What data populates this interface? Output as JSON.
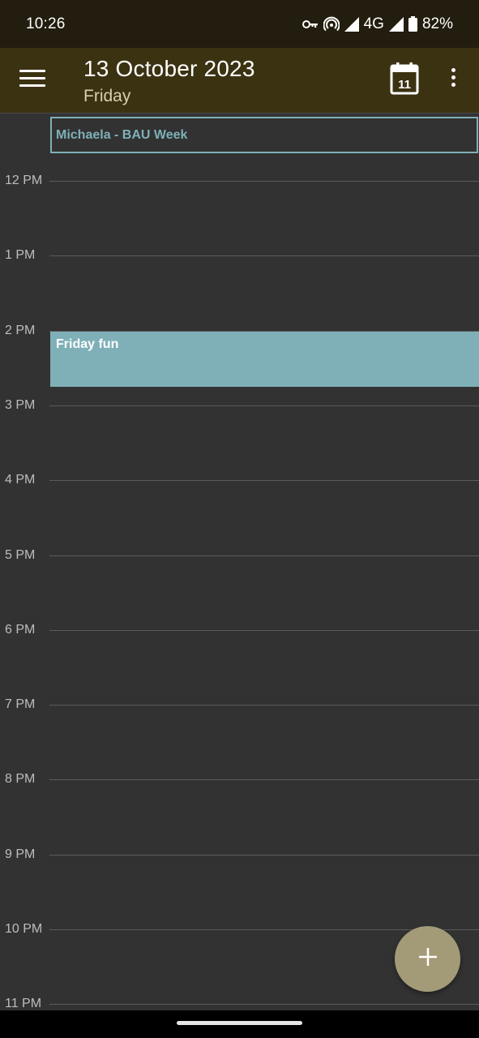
{
  "status_bar": {
    "time": "10:26",
    "network": "4G",
    "battery": "82%",
    "icons": [
      "vpn-key-icon",
      "hotspot-icon",
      "signal-icon",
      "signal-icon",
      "battery-icon"
    ]
  },
  "app_bar": {
    "title": "13 October 2023",
    "subtitle": "Friday",
    "today_day": "11",
    "icons": [
      "menu-icon",
      "calendar-today-icon",
      "more-vert-icon"
    ]
  },
  "colors": {
    "status_bar_bg": "#221d0e",
    "app_bar_bg": "#3b3212",
    "grid_bg": "#323232",
    "event_accent": "#7fb0b8",
    "fab": "#a39a77"
  },
  "timeline": {
    "hours": [
      {
        "label": "12 PM"
      },
      {
        "label": "1 PM"
      },
      {
        "label": "2 PM"
      },
      {
        "label": "3 PM"
      },
      {
        "label": "4 PM"
      },
      {
        "label": "5 PM"
      },
      {
        "label": "6 PM"
      },
      {
        "label": "7 PM"
      },
      {
        "label": "8 PM"
      },
      {
        "label": "9 PM"
      },
      {
        "label": "10 PM"
      },
      {
        "label": "11 PM"
      }
    ]
  },
  "events": {
    "all_day": {
      "title": "Michaela - BAU Week"
    },
    "timed": [
      {
        "title": "Friday fun",
        "start": "2 PM"
      }
    ]
  },
  "fab": {
    "icon": "add-icon"
  }
}
